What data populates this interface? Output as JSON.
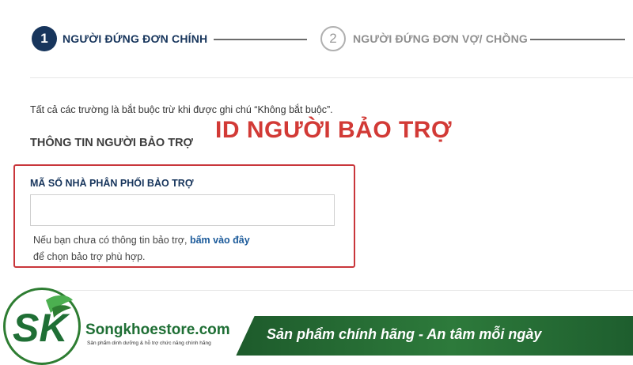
{
  "stepper": {
    "step1": {
      "number": "1",
      "label": "NGƯỜI ĐỨNG ĐƠN CHÍNH"
    },
    "step2": {
      "number": "2",
      "label": "NGƯỜI ĐỨNG ĐƠN VỢ/ CHỒNG"
    }
  },
  "form": {
    "note": "Tất cả các trường là bắt buộc trừ khi được ghi chú “Không bắt buộc”.",
    "section_title": "THÔNG TIN NGƯỜI BẢO TRỢ",
    "overlay_title": "ID NGƯỜI BẢO TRỢ",
    "sponsor_field": {
      "label": "MÃ SỐ NHÀ PHÂN PHỐI BẢO TRỢ",
      "value": "",
      "placeholder": ""
    },
    "help": {
      "prefix": "Nếu bạn chưa có thông tin bảo trợ, ",
      "link": "bấm vào đây",
      "suffix": "để chọn bảo trợ phù hợp."
    }
  },
  "brand": {
    "logo_letters": "SK",
    "name": "Songkhoestore.com",
    "tagline": "Sản phẩm dinh dưỡng & hỗ trợ chức năng chính hãng",
    "slogan": "Sản phẩm chính hãng - An tâm mỗi ngày"
  },
  "colors": {
    "primary_navy": "#17355c",
    "highlight_red": "#c9363b",
    "brand_green": "#2d7a3b"
  }
}
